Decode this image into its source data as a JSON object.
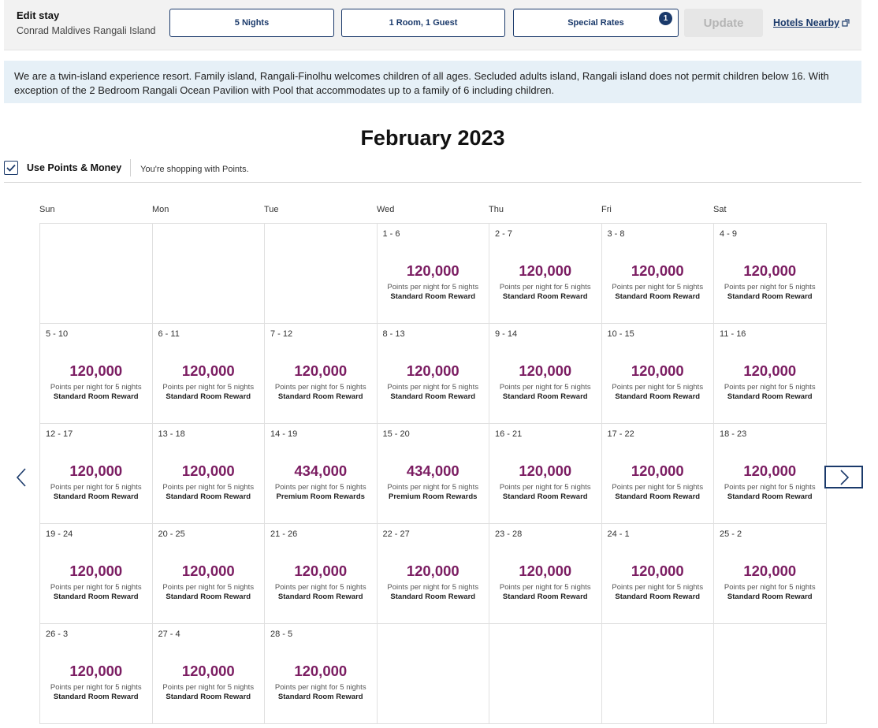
{
  "edit_stay": {
    "title": "Edit stay",
    "hotel_name": "Conrad Maldives Rangali Island",
    "nights_label": "5 Nights",
    "rooms_guests_label": "1 Room, 1 Guest",
    "special_rates_label": "Special Rates",
    "special_rates_badge": "1",
    "update_label": "Update",
    "hotels_nearby_label": "Hotels Nearby"
  },
  "banner": {
    "text": "We are a twin-island experience resort. Family island, Rangali-Finolhu welcomes children of all ages. Secluded adults island, Rangali island does not permit children below 16. With exception of the 2 Bedroom Rangali Ocean Pavilion with Pool that accommodates up to a family of 6 including children."
  },
  "calendar": {
    "month_title": "February 2023",
    "points_toggle_label": "Use Points & Money",
    "points_toggle_checked": true,
    "shopping_note": "You're shopping with Points.",
    "weekdays": [
      "Sun",
      "Mon",
      "Tue",
      "Wed",
      "Thu",
      "Fri",
      "Sat"
    ],
    "per_night_label": "Points per night for 5 nights",
    "cells": [
      null,
      null,
      null,
      {
        "dates": "1 - 6",
        "points": "120,000",
        "room": "Standard Room Reward"
      },
      {
        "dates": "2 - 7",
        "points": "120,000",
        "room": "Standard Room Reward"
      },
      {
        "dates": "3 - 8",
        "points": "120,000",
        "room": "Standard Room Reward"
      },
      {
        "dates": "4 - 9",
        "points": "120,000",
        "room": "Standard Room Reward"
      },
      {
        "dates": "5 - 10",
        "points": "120,000",
        "room": "Standard Room Reward"
      },
      {
        "dates": "6 - 11",
        "points": "120,000",
        "room": "Standard Room Reward"
      },
      {
        "dates": "7 - 12",
        "points": "120,000",
        "room": "Standard Room Reward"
      },
      {
        "dates": "8 - 13",
        "points": "120,000",
        "room": "Standard Room Reward"
      },
      {
        "dates": "9 - 14",
        "points": "120,000",
        "room": "Standard Room Reward"
      },
      {
        "dates": "10 - 15",
        "points": "120,000",
        "room": "Standard Room Reward"
      },
      {
        "dates": "11 - 16",
        "points": "120,000",
        "room": "Standard Room Reward"
      },
      {
        "dates": "12 - 17",
        "points": "120,000",
        "room": "Standard Room Reward"
      },
      {
        "dates": "13 - 18",
        "points": "120,000",
        "room": "Standard Room Reward"
      },
      {
        "dates": "14 - 19",
        "points": "434,000",
        "room": "Premium Room Rewards"
      },
      {
        "dates": "15 - 20",
        "points": "434,000",
        "room": "Premium Room Rewards"
      },
      {
        "dates": "16 - 21",
        "points": "120,000",
        "room": "Standard Room Reward"
      },
      {
        "dates": "17 - 22",
        "points": "120,000",
        "room": "Standard Room Reward"
      },
      {
        "dates": "18 - 23",
        "points": "120,000",
        "room": "Standard Room Reward"
      },
      {
        "dates": "19 - 24",
        "points": "120,000",
        "room": "Standard Room Reward"
      },
      {
        "dates": "20 - 25",
        "points": "120,000",
        "room": "Standard Room Reward"
      },
      {
        "dates": "21 - 26",
        "points": "120,000",
        "room": "Standard Room Reward"
      },
      {
        "dates": "22 - 27",
        "points": "120,000",
        "room": "Standard Room Reward"
      },
      {
        "dates": "23 - 28",
        "points": "120,000",
        "room": "Standard Room Reward"
      },
      {
        "dates": "24 - 1",
        "points": "120,000",
        "room": "Standard Room Reward"
      },
      {
        "dates": "25 - 2",
        "points": "120,000",
        "room": "Standard Room Reward"
      },
      {
        "dates": "26 - 3",
        "points": "120,000",
        "room": "Standard Room Reward"
      },
      {
        "dates": "27 - 4",
        "points": "120,000",
        "room": "Standard Room Reward"
      },
      {
        "dates": "28 - 5",
        "points": "120,000",
        "room": "Standard Room Reward"
      },
      null,
      null,
      null,
      null
    ]
  },
  "colors": {
    "brand_navy": "#1b3a6b",
    "points_purple": "#7b1d62",
    "banner_bg": "#e6f0f7"
  },
  "icons": {
    "prev": "chevron-left-icon",
    "next": "chevron-right-icon",
    "external": "external-link-icon",
    "check": "checkmark-icon"
  }
}
